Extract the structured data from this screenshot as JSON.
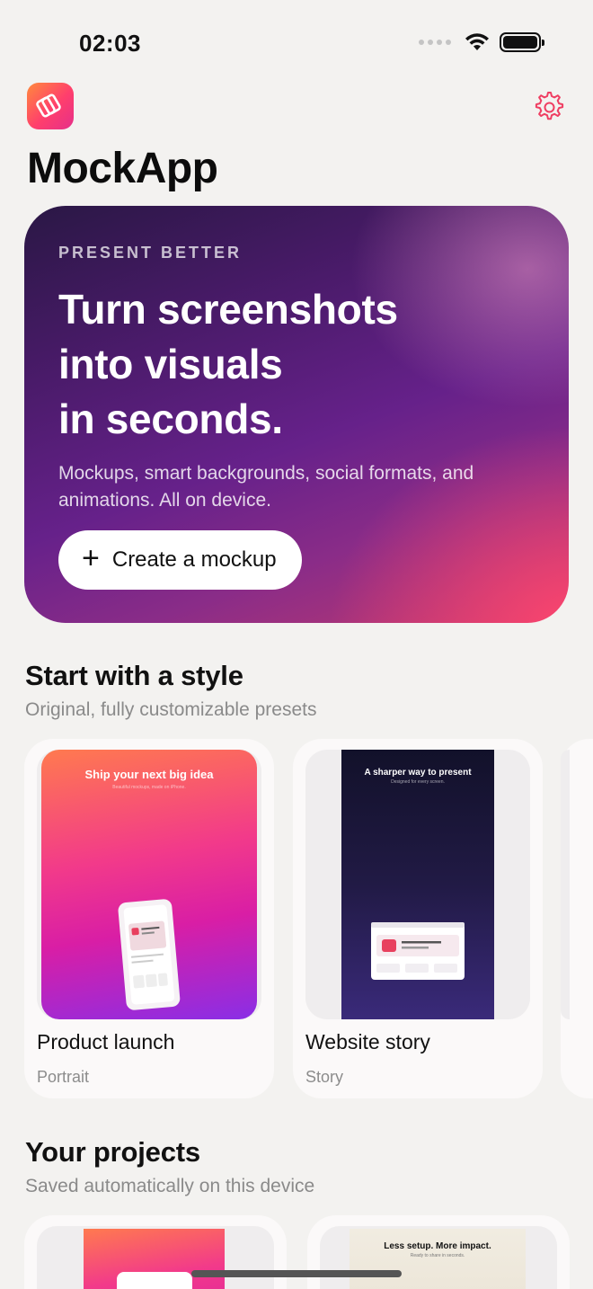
{
  "status_bar": {
    "time": "02:03"
  },
  "header": {
    "app_name": "MockApp"
  },
  "hero": {
    "eyebrow": "PRESENT BETTER",
    "headline_line1": "Turn screenshots",
    "headline_line2": "into visuals",
    "headline_line3": "in seconds.",
    "subtitle": "Mockups, smart backgrounds, social formats, and animations. All on device.",
    "cta_label": "Create a mockup"
  },
  "styles_section": {
    "title": "Start with a style",
    "subtitle": "Original, fully customizable presets",
    "cards": [
      {
        "title": "Product launch",
        "subtitle": "Portrait",
        "preview_title": "Ship your next big idea",
        "preview_sub": "Beautiful mockups, made on iPhone."
      },
      {
        "title": "Website story",
        "subtitle": "Story",
        "preview_title": "A sharper way to present",
        "preview_sub": "Designed for every screen."
      }
    ]
  },
  "projects_section": {
    "title": "Your projects",
    "subtitle": "Saved automatically on this device",
    "items": [
      {
        "preview_title": ""
      },
      {
        "preview_title": "Less setup. More impact.",
        "preview_sub": "Ready to share in seconds."
      }
    ]
  },
  "colors": {
    "accent": "#ff3f6c",
    "background": "#f3f2f0"
  }
}
